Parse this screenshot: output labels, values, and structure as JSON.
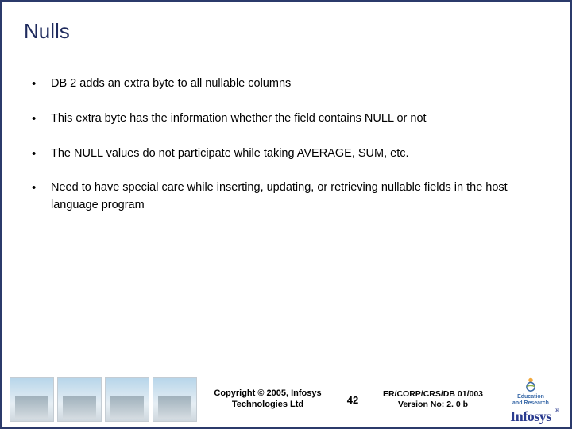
{
  "title": "Nulls",
  "bullets": [
    "DB 2 adds an extra byte to all nullable columns",
    "This extra byte has the information whether the field contains NULL or not",
    "The NULL values do not participate while taking AVERAGE, SUM, etc.",
    "Need to have special care while inserting, updating, or retrieving nullable fields in the host language program"
  ],
  "footer": {
    "copyright_line1": "Copyright © 2005, Infosys",
    "copyright_line2": "Technologies Ltd",
    "page_number": "42",
    "ref_line1": "ER/CORP/CRS/DB 01/003",
    "ref_line2": "Version No: 2. 0 b",
    "edu_label1": "Education",
    "edu_label2": "and Research",
    "company_logo_text": "Infosys",
    "reg_mark": "®"
  }
}
